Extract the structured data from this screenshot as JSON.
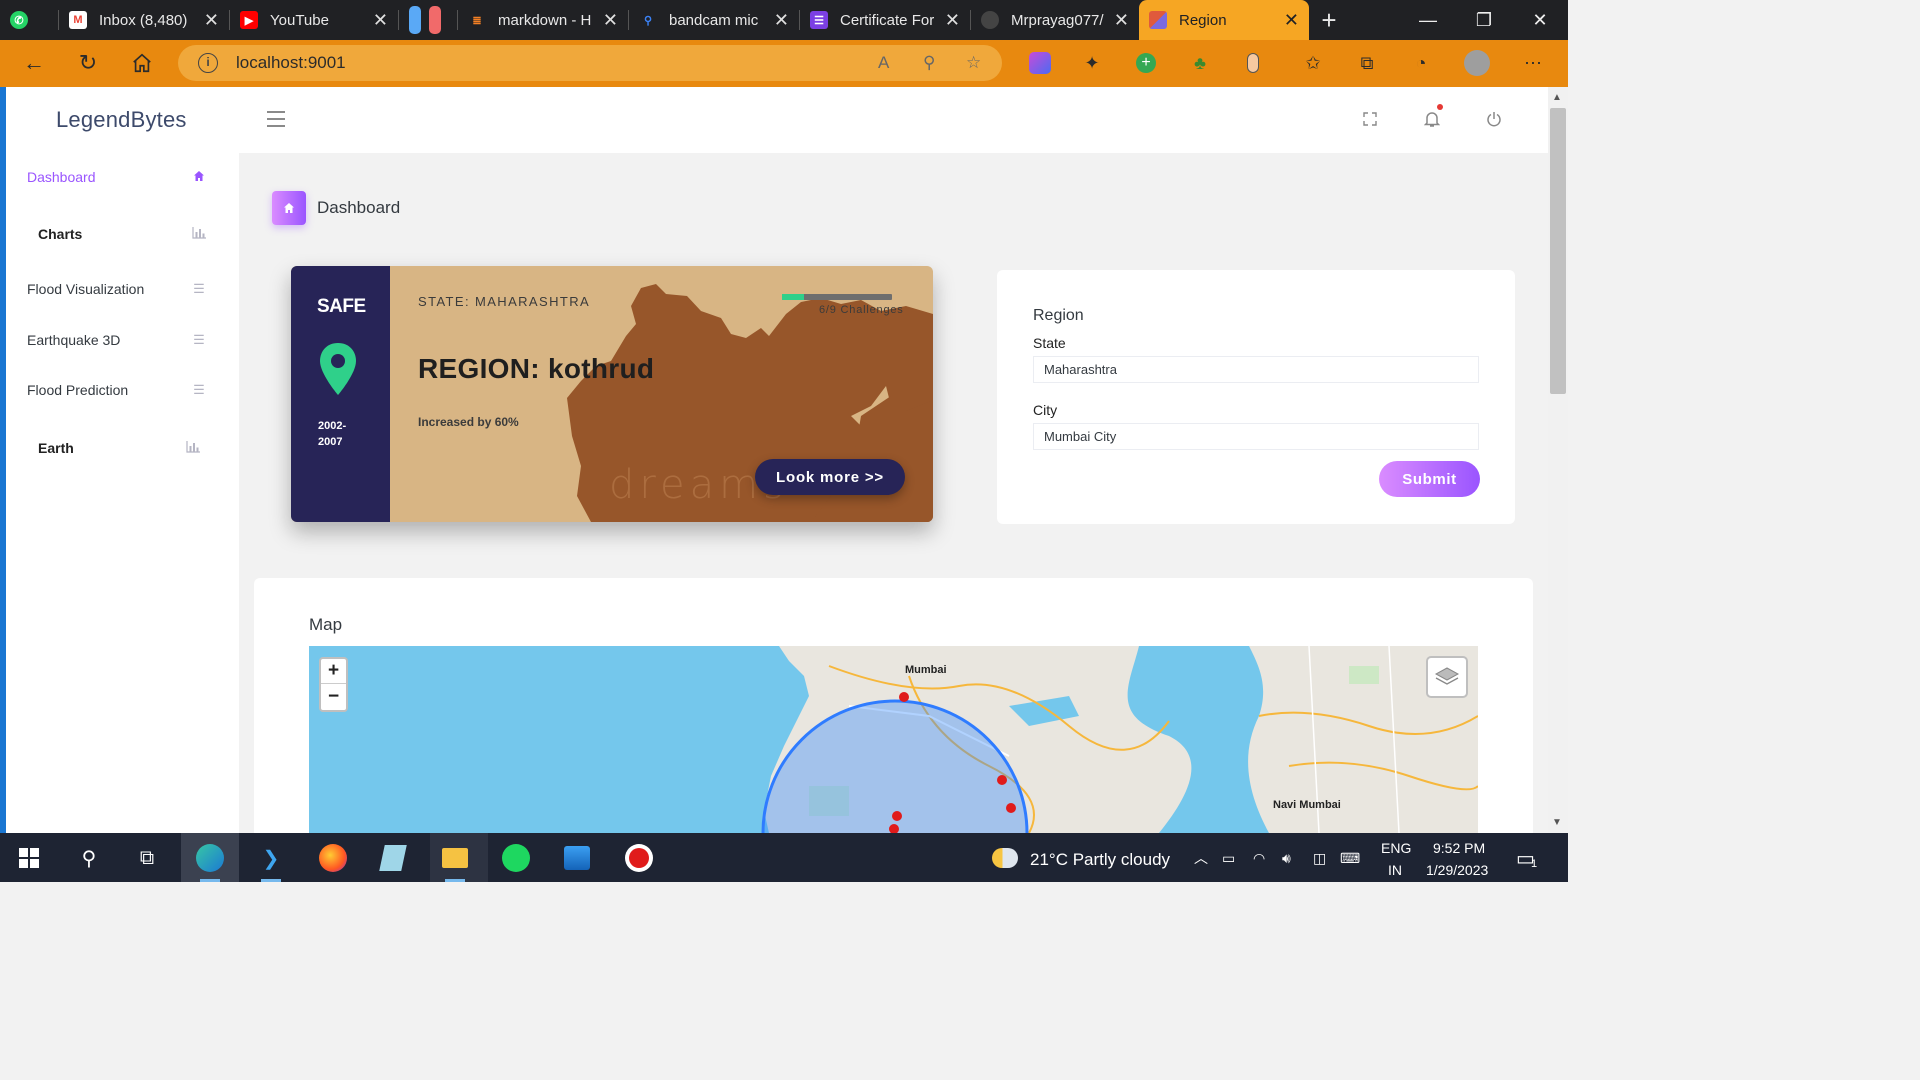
{
  "browser": {
    "tabs": [
      {
        "title": "",
        "icon": "whatsapp-icon",
        "color": "#25d366"
      },
      {
        "title": "Inbox (8,480)",
        "icon": "gmail-icon",
        "color": "#ea4335"
      },
      {
        "title": "YouTube",
        "icon": "youtube-icon",
        "color": "#ff0000"
      },
      {
        "title": "",
        "icon": "tab-group-icon",
        "color": "#5aa9f6"
      },
      {
        "title": "markdown - H",
        "icon": "stack-overflow-icon",
        "color": "#f48024"
      },
      {
        "title": "bandcam mic",
        "icon": "search-icon",
        "color": "#3b82f6"
      },
      {
        "title": "Certificate For",
        "icon": "forms-icon",
        "color": "#7b3fe4"
      },
      {
        "title": "Mrprayag077/",
        "icon": "github-icon",
        "color": "#333333"
      },
      {
        "title": "Region",
        "icon": "app-icon",
        "color": "#e05a3c"
      }
    ],
    "url": "localhost:9001"
  },
  "app": {
    "brand": "LegendBytes"
  },
  "sidebar": {
    "items": [
      {
        "label": "Dashboard",
        "icon": "home-icon"
      },
      {
        "label": "Charts",
        "icon": "bar-chart-icon"
      },
      {
        "label": "Flood Visualization",
        "icon": "list-icon"
      },
      {
        "label": "Earthquake 3D",
        "icon": "list-icon"
      },
      {
        "label": "Flood Prediction",
        "icon": "list-icon"
      },
      {
        "label": "Earth",
        "icon": "bar-chart-icon"
      }
    ]
  },
  "page": {
    "title": "Dashboard"
  },
  "region_card": {
    "status": "SAFE",
    "years": "2002-2007",
    "state": "STATE: MAHARASHTRA",
    "region": "REGION: kothrud",
    "increase": "Increased by 60%",
    "challenges": "6/9 Challenges",
    "progress_fraction": 0.2,
    "watermark": "dreams",
    "button": "Look more >>"
  },
  "region_form": {
    "title": "Region",
    "state_label": "State",
    "state_value": "Maharashtra",
    "city_label": "City",
    "city_value": "Mumbai City",
    "submit": "Submit"
  },
  "map": {
    "title": "Map",
    "zoom_in": "+",
    "zoom_out": "−",
    "labels": {
      "mumbai": "Mumbai",
      "navi_mumbai": "Navi Mumbai"
    }
  },
  "taskbar": {
    "weather": "21°C  Partly cloudy",
    "language_1": "ENG",
    "language_2": "IN",
    "time": "9:52 PM",
    "date": "1/29/2023",
    "notifications": "1"
  },
  "colors": {
    "accent": "#9a55ff",
    "card_dark": "#272457",
    "card_tan": "#d8b584",
    "map_brown": "#97562a",
    "address_bar": "#e8890f",
    "safe_pin": "#2fd08a"
  }
}
